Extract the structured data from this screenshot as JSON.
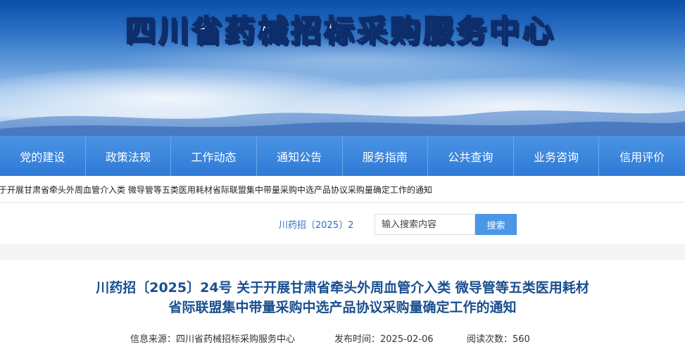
{
  "site": {
    "title": "四川省药械招标采购服务中心"
  },
  "nav": {
    "items": [
      {
        "label": "党的建设"
      },
      {
        "label": "政策法规"
      },
      {
        "label": "工作动态"
      },
      {
        "label": "通知公告"
      },
      {
        "label": "服务指南"
      },
      {
        "label": "公共查询"
      },
      {
        "label": "业务咨询"
      },
      {
        "label": "信用评价"
      }
    ]
  },
  "breadcrumb": {
    "text": "于开展甘肃省牵头外周血管介入类 微导管等五类医用耗材省际联盟集中带量采购中选产品协议采购量确定工作的通知"
  },
  "search": {
    "doc_no": "川药招〔2025〕2",
    "placeholder": "输入搜索内容",
    "button_label": "搜索"
  },
  "article": {
    "title_line1": "川药招〔2025〕24号 关于开展甘肃省牵头外周血管介入类 微导管等五类医用耗材",
    "title_line2": "省际联盟集中带量采购中选产品协议采购量确定工作的通知",
    "source": "信息来源：四川省药械招标采购服务中心",
    "publish_time": "发布时间：2025-02-06",
    "views": "阅读次数：560"
  },
  "colors": {
    "nav_bg": "#3684dc",
    "title_blue": "#1a4f8f",
    "search_button": "#4a97e6"
  }
}
